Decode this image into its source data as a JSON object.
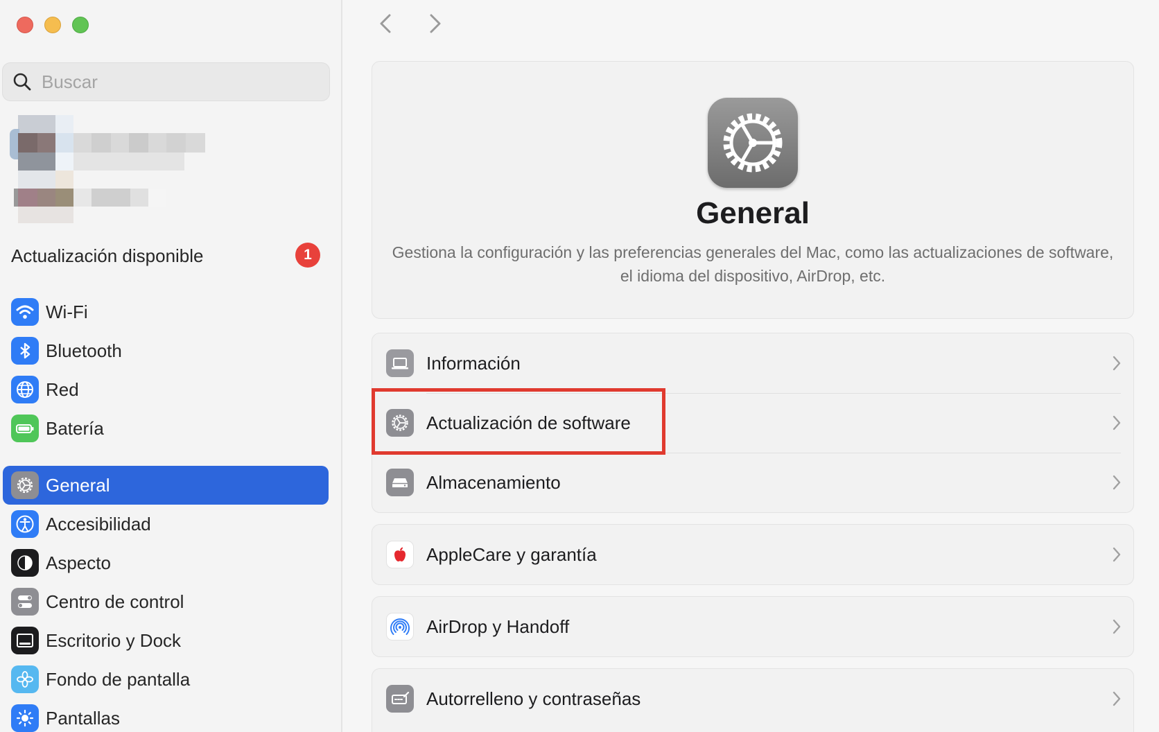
{
  "search": {
    "placeholder": "Buscar"
  },
  "update": {
    "label": "Actualización disponible",
    "badge": "1"
  },
  "sidebar": {
    "group1": [
      {
        "label": "Wi-Fi",
        "icon": "wifi-icon"
      },
      {
        "label": "Bluetooth",
        "icon": "bluetooth-icon"
      },
      {
        "label": "Red",
        "icon": "globe-icon"
      },
      {
        "label": "Batería",
        "icon": "battery-icon"
      }
    ],
    "group2": [
      {
        "label": "General",
        "icon": "gear-icon",
        "selected": true
      },
      {
        "label": "Accesibilidad",
        "icon": "accessibility-icon"
      },
      {
        "label": "Aspecto",
        "icon": "appearance-icon"
      },
      {
        "label": "Centro de control",
        "icon": "control-center-icon"
      },
      {
        "label": "Escritorio y Dock",
        "icon": "dock-icon"
      },
      {
        "label": "Fondo de pantalla",
        "icon": "wallpaper-icon"
      },
      {
        "label": "Pantallas",
        "icon": "displays-icon"
      }
    ]
  },
  "main": {
    "title": "General",
    "description": "Gestiona la configuración y las preferencias generales del Mac, como las actualizaciones de software, el idioma del dispositivo, AirDrop, etc.",
    "group1": [
      {
        "label": "Información",
        "icon": "laptop-icon"
      },
      {
        "label": "Actualización de software",
        "icon": "software-update-icon",
        "highlighted": true
      },
      {
        "label": "Almacenamiento",
        "icon": "storage-icon"
      }
    ],
    "applecare": {
      "label": "AppleCare y garantía",
      "icon": "apple-icon"
    },
    "airdrop": {
      "label": "AirDrop y Handoff",
      "icon": "airdrop-icon"
    },
    "autofill": {
      "label": "Autorrelleno y contraseñas",
      "icon": "autofill-icon"
    }
  },
  "colors": {
    "accent": "#2d66dc",
    "highlight_border": "#e03a2f",
    "badge": "#e8413b"
  }
}
